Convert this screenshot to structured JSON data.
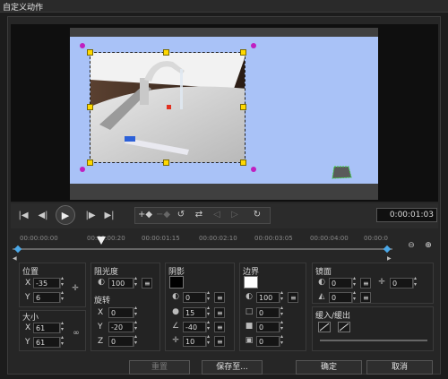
{
  "window": {
    "title": "自定义动作"
  },
  "playback": {
    "timecode": "0:00:01:03"
  },
  "timeline": {
    "ticks": [
      "00:00:00:00",
      "00:00:00:20",
      "00:00:01:15",
      "00:00:02:10",
      "00:00:03:05",
      "00:00:04:00",
      "00:00:0"
    ]
  },
  "position": {
    "label": "位置",
    "x_label": "X",
    "x": "-35",
    "y_label": "Y",
    "y": "6"
  },
  "size": {
    "label": "大小",
    "x_label": "X",
    "x": "61",
    "y_label": "Y",
    "y": "61"
  },
  "opacity": {
    "label": "阻光度",
    "value": "100"
  },
  "rotation": {
    "label": "旋转",
    "x_label": "X",
    "x": "0",
    "y_label": "Y",
    "y": "-20",
    "z_label": "Z",
    "z": "0"
  },
  "shadow": {
    "label": "阴影",
    "color": "#000000",
    "opacity": "0",
    "blur": "15",
    "angle": "-40",
    "distance": "10"
  },
  "border": {
    "label": "边界",
    "color": "#ffffff",
    "opacity": "100",
    "width": "0",
    "soft": "0",
    "other": "0"
  },
  "mirror": {
    "label": "镜面",
    "a": "0",
    "b": "0",
    "c": "0"
  },
  "fade": {
    "label": "缓入/缓出"
  },
  "buttons": {
    "reset": "重置",
    "save_as": "保存至...",
    "ok": "确定",
    "cancel": "取消"
  }
}
